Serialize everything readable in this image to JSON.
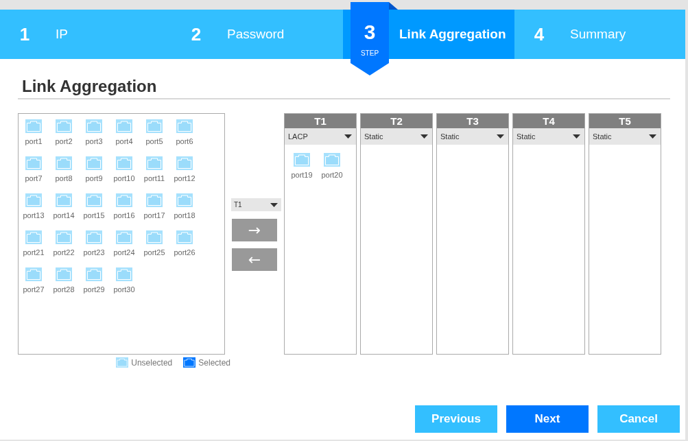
{
  "wizard": {
    "step_caption": "STEP",
    "steps": [
      {
        "number": "1",
        "label": "IP",
        "selected": false
      },
      {
        "number": "2",
        "label": "Password",
        "selected": false
      },
      {
        "number": "3",
        "label": "Link Aggregation",
        "selected": true
      },
      {
        "number": "4",
        "label": "Summary",
        "selected": false
      }
    ]
  },
  "title": "Link Aggregation",
  "available_ports": [
    {
      "label": "port1",
      "selected": false
    },
    {
      "label": "port2",
      "selected": false
    },
    {
      "label": "port3",
      "selected": false
    },
    {
      "label": "port4",
      "selected": false
    },
    {
      "label": "port5",
      "selected": false
    },
    {
      "label": "port6",
      "selected": false
    },
    {
      "label": "port7",
      "selected": false
    },
    {
      "label": "port8",
      "selected": false
    },
    {
      "label": "port9",
      "selected": false
    },
    {
      "label": "port10",
      "selected": false
    },
    {
      "label": "port11",
      "selected": false
    },
    {
      "label": "port12",
      "selected": false
    },
    {
      "label": "port13",
      "selected": false
    },
    {
      "label": "port14",
      "selected": false
    },
    {
      "label": "port15",
      "selected": false
    },
    {
      "label": "port16",
      "selected": false
    },
    {
      "label": "port17",
      "selected": false
    },
    {
      "label": "port18",
      "selected": false
    },
    {
      "label": "port21",
      "selected": false
    },
    {
      "label": "port22",
      "selected": false
    },
    {
      "label": "port23",
      "selected": false
    },
    {
      "label": "port24",
      "selected": false
    },
    {
      "label": "port25",
      "selected": false
    },
    {
      "label": "port26",
      "selected": false
    },
    {
      "label": "port27",
      "selected": false
    },
    {
      "label": "port28",
      "selected": false
    },
    {
      "label": "port29",
      "selected": false
    },
    {
      "label": "port30",
      "selected": false
    }
  ],
  "legend": [
    {
      "kind": "unselected",
      "label": "Unselected"
    },
    {
      "kind": "selected",
      "label": "Selected"
    }
  ],
  "target_select": {
    "value": "T1"
  },
  "move_buttons": [
    {
      "label": "→"
    },
    {
      "label": "←"
    }
  ],
  "trunks": [
    {
      "name": "T1",
      "mode": "LACP",
      "ports": [
        {
          "label": "port19",
          "selected": false
        },
        {
          "label": "port20",
          "selected": false
        }
      ]
    },
    {
      "name": "T2",
      "mode": "Static"
    },
    {
      "name": "T3",
      "mode": "Static"
    },
    {
      "name": "T4",
      "mode": "Static"
    },
    {
      "name": "T5",
      "mode": "Static"
    }
  ],
  "buttons": [
    {
      "label": "Previous",
      "kind": "secondary"
    },
    {
      "label": "Next",
      "kind": "primary"
    },
    {
      "label": "Cancel",
      "kind": "secondary"
    }
  ]
}
